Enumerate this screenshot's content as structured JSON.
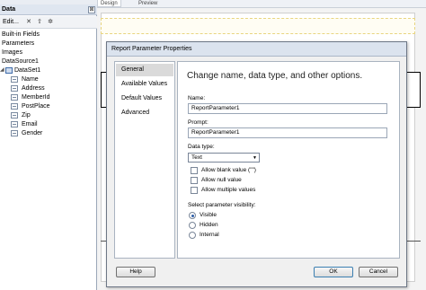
{
  "designer": {
    "tabs": [
      "Design",
      "Preview"
    ]
  },
  "data_panel": {
    "title": "Data",
    "close_glyph": "⊠",
    "toolbar": {
      "edit_label": "Edit...",
      "delete_glyph": "✕",
      "up_glyph": "⇧",
      "refresh_glyph": "✲"
    },
    "tree": [
      {
        "label": "Built-in Fields",
        "level": 0,
        "icon": "none"
      },
      {
        "label": "Parameters",
        "level": 0,
        "icon": "none"
      },
      {
        "label": "Images",
        "level": 0,
        "icon": "none"
      },
      {
        "label": "DataSource1",
        "level": 0,
        "icon": "none"
      },
      {
        "label": "DataSet1",
        "level": 1,
        "icon": "database-icon",
        "expanded": true
      },
      {
        "label": "Name",
        "level": 2,
        "icon": "field-icon"
      },
      {
        "label": "Address",
        "level": 2,
        "icon": "field-icon"
      },
      {
        "label": "MemberId",
        "level": 2,
        "icon": "field-icon"
      },
      {
        "label": "PostPlace",
        "level": 2,
        "icon": "field-icon"
      },
      {
        "label": "Zip",
        "level": 2,
        "icon": "field-icon"
      },
      {
        "label": "Email",
        "level": 2,
        "icon": "field-icon"
      },
      {
        "label": "Gender",
        "level": 2,
        "icon": "field-icon"
      }
    ]
  },
  "dialog": {
    "title": "Report Parameter Properties",
    "nav": [
      "General",
      "Available Values",
      "Default Values",
      "Advanced"
    ],
    "selected_nav": "General",
    "heading": "Change name, data type, and other options.",
    "name_label": "Name:",
    "name_value": "ReportParameter1",
    "prompt_label": "Prompt:",
    "prompt_value": "ReportParameter1",
    "data_type_label": "Data type:",
    "data_type_value": "Text",
    "checkboxes": [
      {
        "label": "Allow blank value (\"\")",
        "checked": false
      },
      {
        "label": "Allow null value",
        "checked": false
      },
      {
        "label": "Allow multiple values",
        "checked": false
      }
    ],
    "visibility_label": "Select parameter visibility:",
    "visibility_options": [
      {
        "label": "Visible",
        "selected": true
      },
      {
        "label": "Hidden",
        "selected": false
      },
      {
        "label": "Internal",
        "selected": false
      }
    ],
    "help_button": "Help",
    "ok_button": "OK",
    "cancel_button": "Cancel"
  }
}
